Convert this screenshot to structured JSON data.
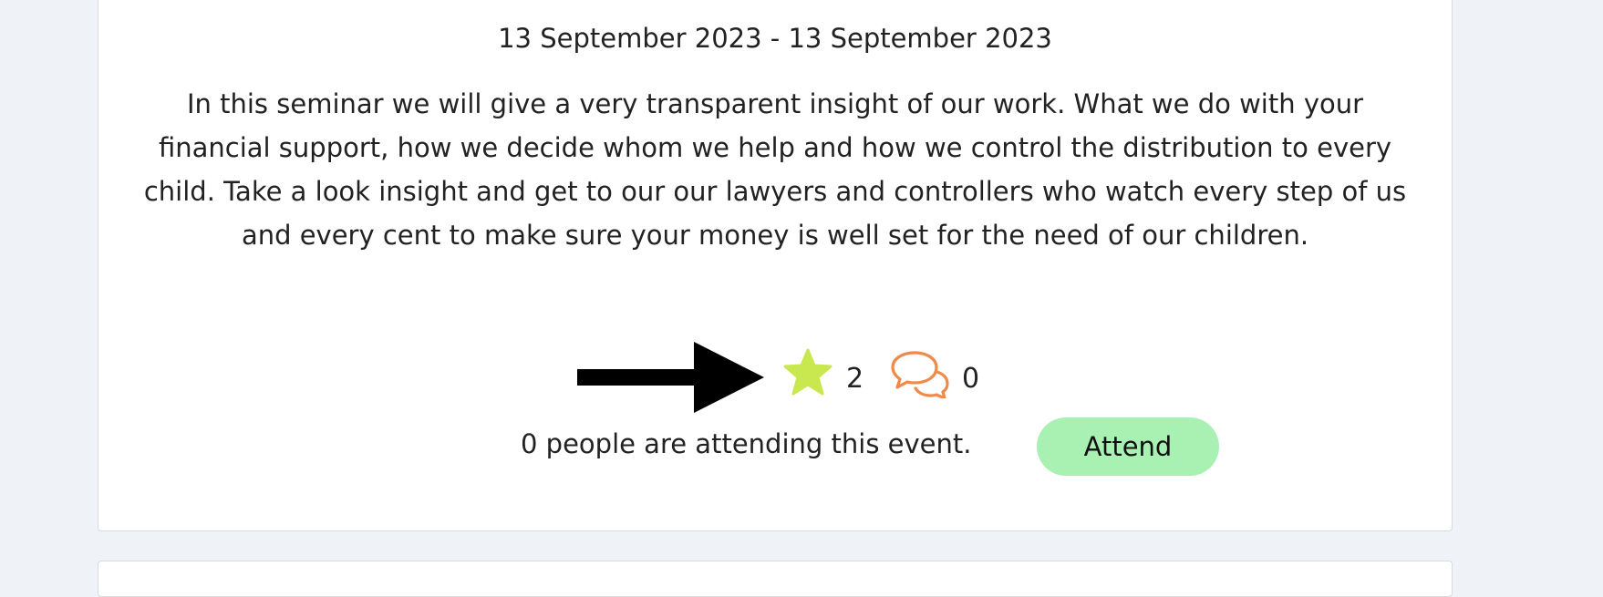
{
  "event": {
    "date_range": "13 September 2023 - 13 September 2023",
    "description": "In this seminar we will give a very transparent insight of our work. What we do with your financial support, how we decide whom we help and how we control the distribution to every child. Take a look insight and get to our our lawyers and controllers who watch every step of us and every cent to make sure your money is well set for the need of our children.",
    "star_count": "2",
    "comment_count": "0",
    "attending_text": "0 people are attending this event.",
    "attend_label": "Attend"
  },
  "icons": {
    "annotation": "arrow-right-icon",
    "star": "star-icon",
    "comment": "comment-bubbles-icon"
  },
  "colors": {
    "background": "#eff3f7",
    "card": "#ffffff",
    "star": "#c9e84f",
    "comment": "#f08a4b",
    "attend_button": "#a9f0b3",
    "arrow": "#000000"
  }
}
